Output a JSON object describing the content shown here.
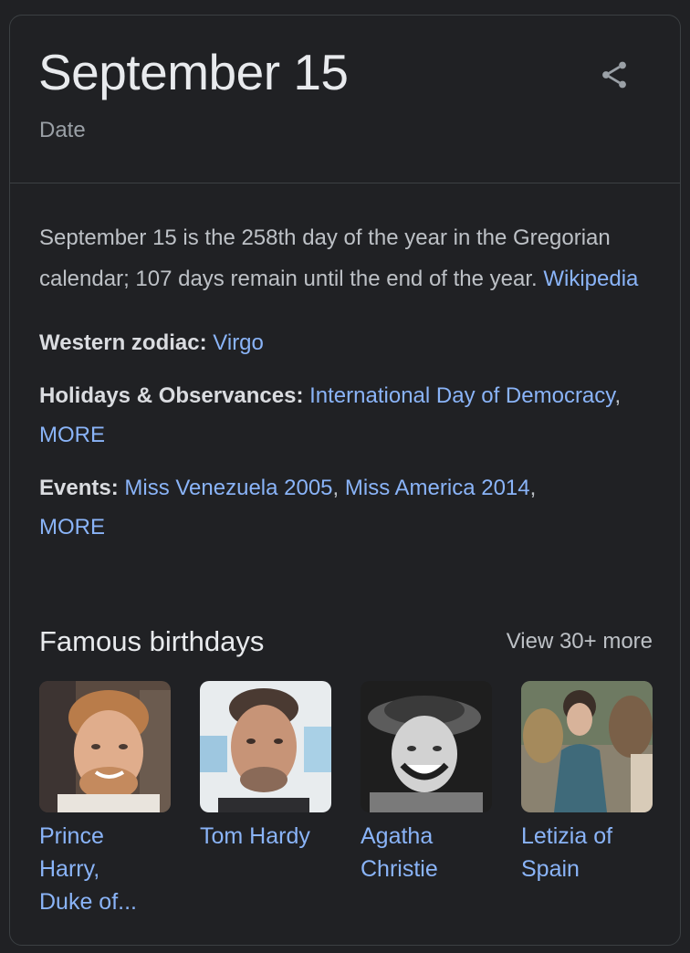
{
  "header": {
    "title": "September 15",
    "subtitle": "Date",
    "share_icon": "share-icon"
  },
  "description": {
    "text": "September 15 is the 258th day of the year in the Gregorian calendar; 107 days remain until the end of the year. ",
    "source_link": "Wikipedia"
  },
  "facts": {
    "zodiac_label": "Western zodiac:",
    "zodiac_value": "Virgo",
    "holidays_label": "Holidays & Observances:",
    "holidays_link": "International Day of Democracy",
    "holidays_sep": ", ",
    "holidays_more": "MORE",
    "events_label": "Events:",
    "events_link1": "Miss Venezuela 2005",
    "events_sep1": ", ",
    "events_link2": "Miss America 2014",
    "events_sep2": ",",
    "events_more": "MORE"
  },
  "birthdays": {
    "title": "Famous birthdays",
    "view_more": "View 30+ more",
    "people": [
      {
        "name_line1": "Prince",
        "name_line2": "Harry,",
        "name_line3": "Duke of..."
      },
      {
        "name_line1": "Tom Hardy"
      },
      {
        "name_line1": "Agatha",
        "name_line2": "Christie"
      },
      {
        "name_line1": "Letizia of",
        "name_line2": "Spain"
      }
    ]
  },
  "colors": {
    "background": "#202124",
    "link": "#8ab4f8",
    "title": "#e8eaed",
    "text": "#bdc1c6",
    "border": "#3c4043"
  }
}
